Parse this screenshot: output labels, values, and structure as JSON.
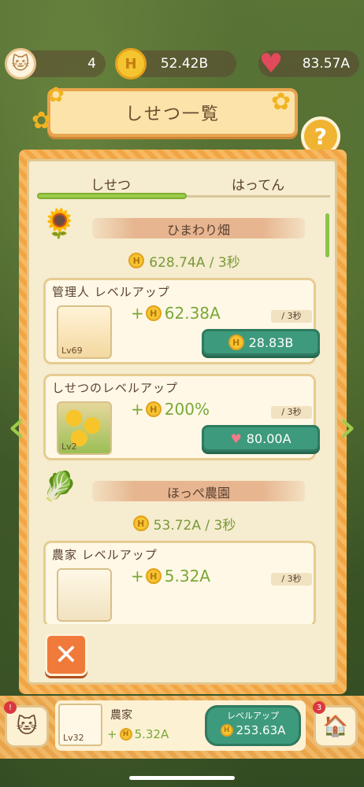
{
  "hud": {
    "cats": "4",
    "coins": "52.42B",
    "hearts": "83.57A",
    "coin_icon": "H",
    "cat_icon": "cat-face-icon",
    "heart_icon": "heart-icon"
  },
  "title": "しせつ一覧",
  "help_label": "?",
  "tabs": [
    {
      "label": "しせつ",
      "active": true
    },
    {
      "label": "はってん",
      "active": false
    }
  ],
  "sections": [
    {
      "name": "ひまわり畑",
      "rate": "628.74A / 3秒",
      "cards": [
        {
          "title": "管理人 レベルアップ",
          "level": "Lv69",
          "gain": "62.38A",
          "per": "/ 3秒",
          "cost": "28.83B",
          "cost_type": "coin"
        },
        {
          "title": "しせつのレベルアップ",
          "level": "Lv2",
          "gain": "200%",
          "per": "/ 3秒",
          "cost": "80.00A",
          "cost_type": "heart"
        }
      ]
    },
    {
      "name": "ほっぺ農園",
      "rate": "53.72A / 3秒",
      "cards": [
        {
          "title": "農家 レベルアップ",
          "gain": "5.32A",
          "per": "/ 3秒"
        }
      ]
    }
  ],
  "close_label": "✕",
  "bottom": {
    "name": "農家",
    "level": "Lv32",
    "gain": "5.32A",
    "button_label": "レベルアップ",
    "button_cost": "253.63A",
    "left_badge": "!",
    "right_badge": "3"
  },
  "colors": {
    "accent_green": "#9ccc4a",
    "button_teal": "#3e9a7c",
    "frame_orange": "#f2a544",
    "panel_cream": "#f6eccf"
  }
}
